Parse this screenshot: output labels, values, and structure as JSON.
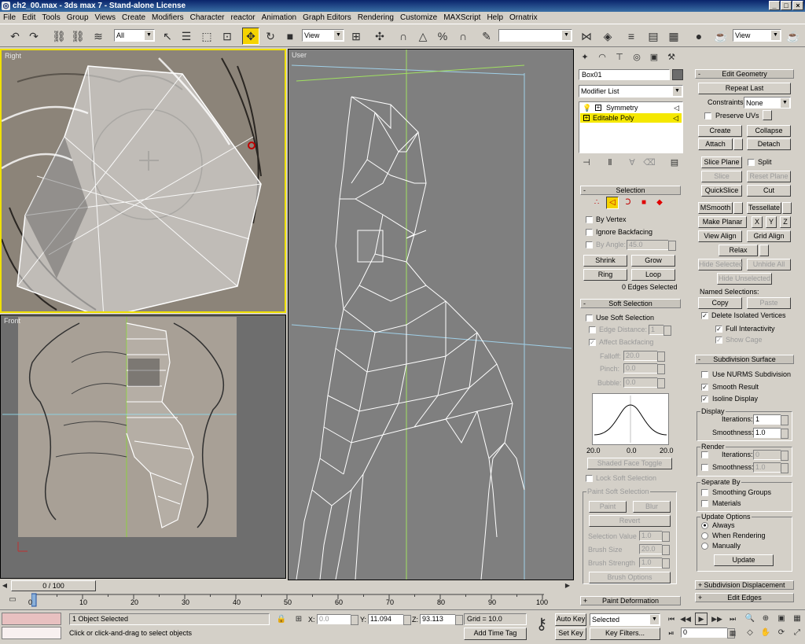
{
  "window": {
    "title": "ch2_00.max - 3ds max 7 - Stand-alone License",
    "min": "_",
    "max": "□",
    "close": "×"
  },
  "menu": [
    "File",
    "Edit",
    "Tools",
    "Group",
    "Views",
    "Create",
    "Modifiers",
    "Character",
    "reactor",
    "Animation",
    "Graph Editors",
    "Rendering",
    "Customize",
    "MAXScript",
    "Help",
    "Ornatrix"
  ],
  "toolbar": {
    "selection_filter": "All",
    "ref_coord": "View",
    "named_sel": "",
    "render_type": "View"
  },
  "viewports": {
    "top_left": "Right",
    "bottom_left": "Front",
    "main": "User"
  },
  "modify": {
    "object_name": "Box01",
    "modifier_list": "Modifier List",
    "stack": [
      "Symmetry",
      "Editable Poly"
    ],
    "selection": {
      "title": "Selection",
      "by_vertex": "By Vertex",
      "ignore_backfacing": "Ignore Backfacing",
      "by_angle": "By Angle:",
      "by_angle_val": "45.0",
      "shrink": "Shrink",
      "grow": "Grow",
      "ring": "Ring",
      "loop": "Loop",
      "status": "0 Edges Selected"
    },
    "soft": {
      "title": "Soft Selection",
      "use": "Use Soft Selection",
      "edge_distance": "Edge Distance:",
      "edge_val": "1",
      "affect_backfacing": "Affect Backfacing",
      "falloff": "Falloff:",
      "falloff_val": "20.0",
      "pinch": "Pinch:",
      "pinch_val": "0.0",
      "bubble": "Bubble:",
      "bubble_val": "0.0",
      "curve_left": "20.0",
      "curve_mid": "0.0",
      "curve_right": "20.0",
      "shaded_face": "Shaded Face Toggle",
      "lock": "Lock Soft Selection",
      "paint_title": "Paint Soft Selection",
      "paint": "Paint",
      "blur": "Blur",
      "revert": "Revert",
      "sel_value": "Selection Value",
      "sel_value_val": "1.0",
      "brush_size": "Brush Size",
      "brush_size_val": "20.0",
      "brush_strength": "Brush Strength",
      "brush_strength_val": "1.0",
      "brush_options": "Brush Options"
    },
    "paint_deformation": "Paint Deformation"
  },
  "edit_geometry": {
    "title": "Edit Geometry",
    "repeat_last": "Repeat Last",
    "constraints": "Constraints:",
    "constraints_val": "None",
    "preserve_uvs": "Preserve UVs",
    "create": "Create",
    "collapse": "Collapse",
    "attach": "Attach",
    "detach": "Detach",
    "slice_plane": "Slice Plane",
    "split": "Split",
    "slice": "Slice",
    "reset_plane": "Reset Plane",
    "quickslice": "QuickSlice",
    "cut": "Cut",
    "msmooth": "MSmooth",
    "tessellate": "Tessellate",
    "make_planar": "Make Planar",
    "x": "X",
    "y": "Y",
    "z": "Z",
    "view_align": "View Align",
    "grid_align": "Grid Align",
    "relax": "Relax",
    "hide_selected": "Hide Selected",
    "unhide_all": "Unhide All",
    "hide_unselected": "Hide Unselected",
    "named_selections": "Named Selections:",
    "copy": "Copy",
    "paste": "Paste",
    "delete_isolated": "Delete Isolated Vertices",
    "full_interactivity": "Full Interactivity",
    "show_cage": "Show Cage"
  },
  "subdivision": {
    "title": "Subdivision Surface",
    "use_nurms": "Use NURMS Subdivision",
    "smooth_result": "Smooth Result",
    "isoline": "Isoline Display",
    "display": "Display",
    "iterations": "Iterations:",
    "iter_val": "1",
    "smoothness": "Smoothness:",
    "smooth_val": "1.0",
    "render": "Render",
    "r_iter_val": "0",
    "r_smooth_val": "1.0",
    "separate_by": "Separate By",
    "smoothing_groups": "Smoothing Groups",
    "materials": "Materials",
    "update_options": "Update Options",
    "always": "Always",
    "when_rendering": "When Rendering",
    "manually": "Manually",
    "update": "Update",
    "subdiv_disp": "Subdivision Displacement",
    "edit_edges": "Edit Edges"
  },
  "timeline": {
    "frame": "0 / 100",
    "ticks": [
      "0",
      "10",
      "20",
      "30",
      "40",
      "50",
      "60",
      "70",
      "80",
      "90",
      "100"
    ]
  },
  "status": {
    "objects": "1 Object Selected",
    "prompt": "Click or click-and-drag to select objects",
    "x_label": "X:",
    "x_val": "0.0",
    "y_label": "Y:",
    "y_val": "11.094",
    "z_label": "Z:",
    "z_val": "93.113",
    "grid": "Grid = 10.0",
    "add_time_tag": "Add Time Tag",
    "auto_key": "Auto Key",
    "set_key": "Set Key",
    "selected": "Selected",
    "key_filters": "Key Filters...",
    "frame_field": "0"
  }
}
